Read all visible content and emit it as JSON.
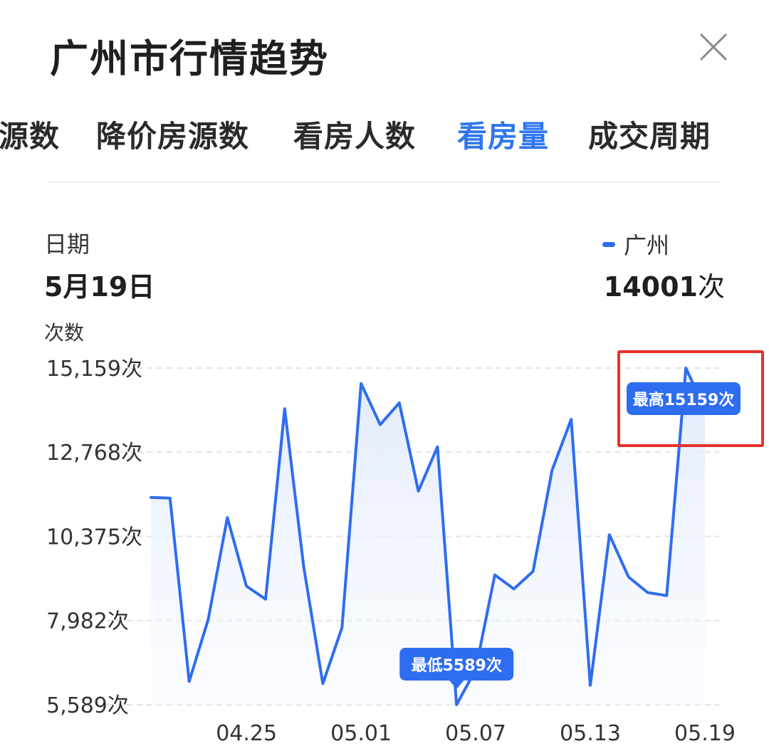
{
  "header": {
    "title": "广州市行情趋势",
    "close_icon": "close-icon"
  },
  "tabs": [
    {
      "label": "源数",
      "active": false
    },
    {
      "label": "降价房源数",
      "active": false
    },
    {
      "label": "看房人数",
      "active": false
    },
    {
      "label": "看房量",
      "active": true
    },
    {
      "label": "成交周期",
      "active": false
    }
  ],
  "summary": {
    "date_label": "日期",
    "date_value": "5月19日",
    "legend_name": "广州",
    "legend_number": "14001",
    "legend_unit": "次"
  },
  "colors": {
    "accent": "#2e76f0",
    "line": "#2e6df0",
    "highlight": "#e5332a"
  },
  "chart_data": {
    "type": "line",
    "ylabel": "次数",
    "y_ticks": [
      "15,159次",
      "12,768次",
      "10,375次",
      "7,982次",
      "5,589次"
    ],
    "y_tick_values": [
      15159,
      12768,
      10375,
      7982,
      5589
    ],
    "ylim": [
      5589,
      15159
    ],
    "x_tick_labels": [
      "04.25",
      "05.01",
      "05.07",
      "05.13",
      "05.19"
    ],
    "x": [
      "04.20",
      "04.21",
      "04.22",
      "04.23",
      "04.24",
      "04.25",
      "04.26",
      "04.27",
      "04.28",
      "04.29",
      "04.30",
      "05.01",
      "05.02",
      "05.03",
      "05.04",
      "05.05",
      "05.06",
      "05.07",
      "05.08",
      "05.09",
      "05.10",
      "05.11",
      "05.12",
      "05.13",
      "05.14",
      "05.15",
      "05.16",
      "05.17",
      "05.18",
      "05.19"
    ],
    "series": [
      {
        "name": "广州",
        "values": [
          11480,
          11460,
          6250,
          8020,
          10910,
          8960,
          8590,
          14000,
          9500,
          6190,
          7780,
          14720,
          13550,
          14170,
          11660,
          12920,
          5589,
          6590,
          9280,
          8880,
          9380,
          12260,
          13700,
          6140,
          10420,
          9220,
          8780,
          8690,
          15159,
          14001
        ]
      }
    ],
    "grid": true,
    "annotations": [
      {
        "label": "最高15159次",
        "value": 15159
      },
      {
        "label": "最低5589次",
        "value": 5589
      }
    ]
  }
}
